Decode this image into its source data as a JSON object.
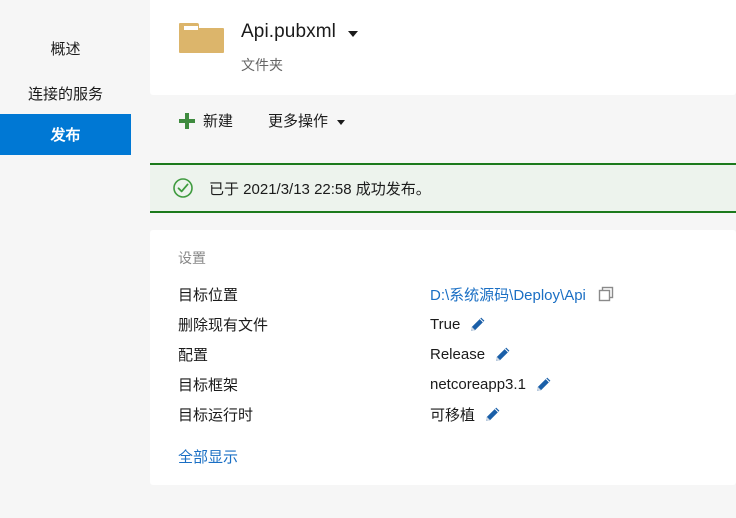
{
  "colors": {
    "accent": "#0078d4",
    "link": "#1a6fc4",
    "success_border": "#1c7a1c",
    "success_bg": "#edf3ed",
    "plus_green": "#3f8b3f",
    "folder": "#dcb56b",
    "page_bg": "#f6f6f6",
    "card_bg": "#ffffff"
  },
  "sidebar": {
    "items": [
      {
        "label": "概述",
        "active": false
      },
      {
        "label": "连接的服务",
        "active": false
      },
      {
        "label": "发布",
        "active": true
      }
    ]
  },
  "header": {
    "icon": "folder-icon",
    "title": "Api.pubxml",
    "subtitle": "文件夹",
    "dropdown_icon": "chevron-down-icon"
  },
  "toolbar": {
    "new_label": "新建",
    "new_icon": "plus-icon",
    "more_label": "更多操作",
    "more_icon": "chevron-down-icon"
  },
  "banner": {
    "icon": "check-circle-icon",
    "text": "已于 2021/3/13 22:58 成功发布。"
  },
  "settings": {
    "title": "设置",
    "rows": [
      {
        "label": "目标位置",
        "value": "D:\\系统源码\\Deploy\\Api",
        "is_link": true,
        "action_icon": "copy-icon"
      },
      {
        "label": "删除现有文件",
        "value": "True",
        "is_link": false,
        "action_icon": "pencil-icon"
      },
      {
        "label": "配置",
        "value": "Release",
        "is_link": false,
        "action_icon": "pencil-icon"
      },
      {
        "label": "目标框架",
        "value": "netcoreapp3.1",
        "is_link": false,
        "action_icon": "pencil-icon"
      },
      {
        "label": "目标运行时",
        "value": "可移植",
        "is_link": false,
        "action_icon": "pencil-icon"
      }
    ],
    "show_all_label": "全部显示"
  }
}
